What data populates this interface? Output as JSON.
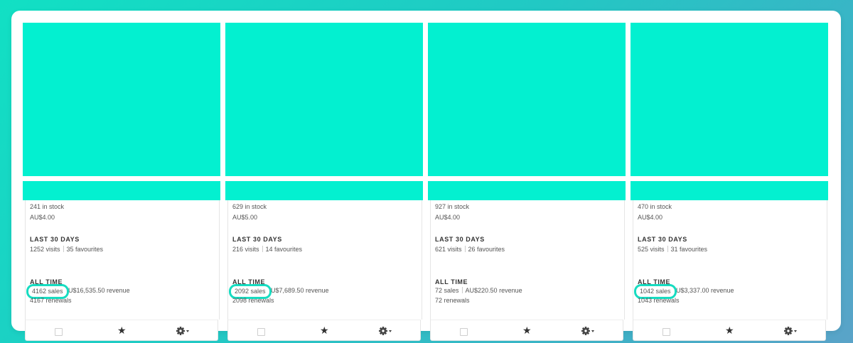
{
  "cards": [
    {
      "stock": "241 in stock",
      "price": "AU$4.00",
      "last30_heading": "LAST 30 DAYS",
      "visits": "1252 visits",
      "favourites": "35 favourites",
      "alltime_heading": "ALL TIME",
      "sales": "4162 sales",
      "revenue": "AU$16,535.50 revenue",
      "renewals": "4167 renewals"
    },
    {
      "stock": "629 in stock",
      "price": "AU$5.00",
      "last30_heading": "LAST 30 DAYS",
      "visits": "216 visits",
      "favourites": "14 favourites",
      "alltime_heading": "ALL TIME",
      "sales": "2092 sales",
      "revenue": "AU$7,689.50 revenue",
      "renewals": "2098 renewals"
    },
    {
      "stock": "927 in stock",
      "price": "AU$4.00",
      "last30_heading": "LAST 30 DAYS",
      "visits": "621 visits",
      "favourites": "26 favourites",
      "alltime_heading": "ALL TIME",
      "sales": "72 sales",
      "revenue": "AU$220.50 revenue",
      "renewals": "72 renewals"
    },
    {
      "stock": "470 in stock",
      "price": "AU$4.00",
      "last30_heading": "LAST 30 DAYS",
      "visits": "525 visits",
      "favourites": "31 favourites",
      "alltime_heading": "ALL TIME",
      "sales": "1042 sales",
      "revenue": "AU$3,337.00 revenue",
      "renewals": "1043 renewals"
    }
  ],
  "icons": {
    "checkbox": "checkbox-icon",
    "star": "star-icon",
    "gear": "gear-icon",
    "caret": "caret-down-icon"
  },
  "colors": {
    "thumbnail": "#03f0d0",
    "highlight": "#17dcc1"
  }
}
